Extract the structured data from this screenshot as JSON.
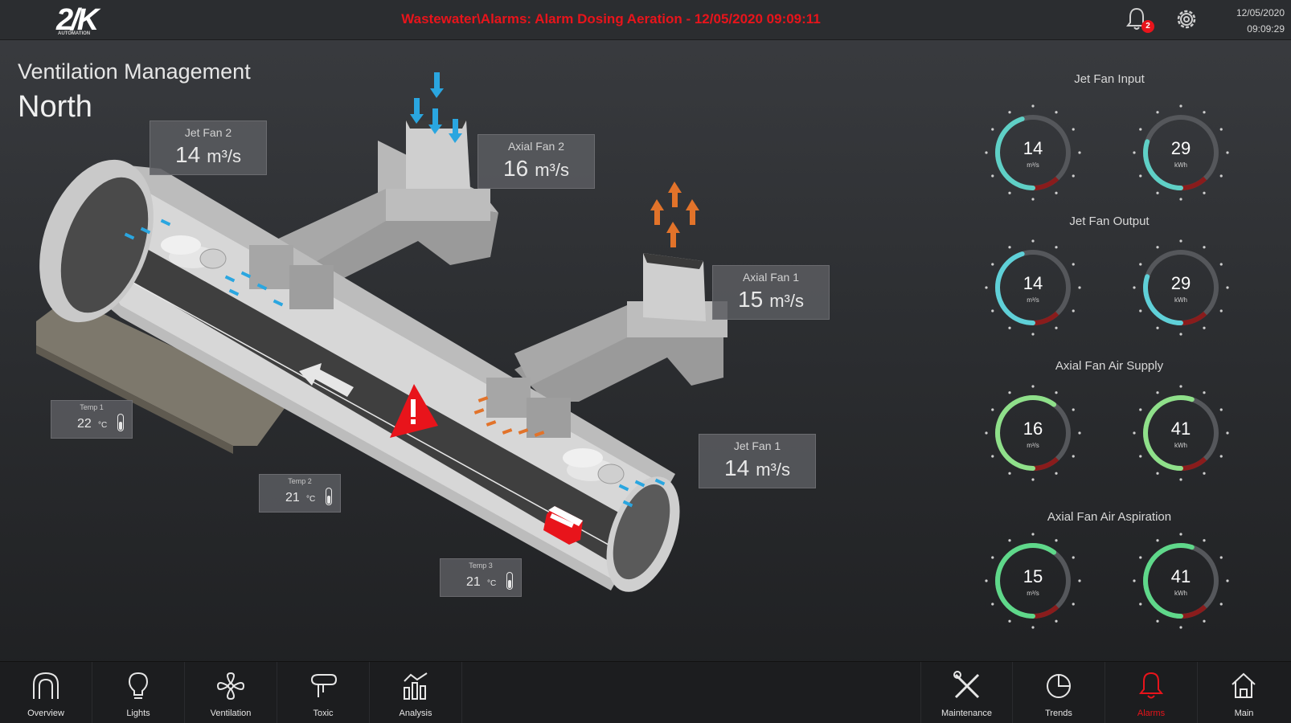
{
  "header": {
    "logo_text": "2/K",
    "logo_sub": "AUTOMATION",
    "alarm_message": "Wastewater\\Alarms: Alarm Dosing Aeration - 12/05/2020 09:09:11",
    "notification_count": "2",
    "date": "12/05/2020",
    "time": "09:09:29"
  },
  "page": {
    "subtitle": "Ventilation Management",
    "title": "North"
  },
  "readouts": {
    "jet_fan_2": {
      "label": "Jet Fan 2",
      "value": "14",
      "unit": "m³/s"
    },
    "axial_fan_2": {
      "label": "Axial Fan 2",
      "value": "16",
      "unit": "m³/s"
    },
    "axial_fan_1": {
      "label": "Axial Fan 1",
      "value": "15",
      "unit": "m³/s"
    },
    "jet_fan_1": {
      "label": "Jet Fan 1",
      "value": "14",
      "unit": "m³/s"
    }
  },
  "temps": {
    "temp_1": {
      "label": "Temp 1",
      "value": "22",
      "unit": "°C"
    },
    "temp_2": {
      "label": "Temp 2",
      "value": "21",
      "unit": "°C"
    },
    "temp_3": {
      "label": "Temp 3",
      "value": "21",
      "unit": "°C"
    }
  },
  "gauges": {
    "jet_fan_input": {
      "title": "Jet Fan Input",
      "flow": {
        "value": "14",
        "unit": "m³/s",
        "fraction": 0.45,
        "color": "#5fd0c6"
      },
      "power": {
        "value": "29",
        "unit": "kWh",
        "fraction": 0.3,
        "color": "#5fd0c6"
      }
    },
    "jet_fan_output": {
      "title": "Jet Fan Output",
      "flow": {
        "value": "14",
        "unit": "m³/s",
        "fraction": 0.45,
        "color": "#5fd0d8"
      },
      "power": {
        "value": "29",
        "unit": "kWh",
        "fraction": 0.3,
        "color": "#5fd0d8"
      }
    },
    "axial_fan_air_supply": {
      "title": "Axial Fan Air Supply",
      "flow": {
        "value": "16",
        "unit": "m³/s",
        "fraction": 0.6,
        "color": "#8fe08a"
      },
      "power": {
        "value": "41",
        "unit": "kWh",
        "fraction": 0.55,
        "color": "#8fe08a"
      }
    },
    "axial_fan_air_aspiration": {
      "title": "Axial Fan Air Aspiration",
      "flow": {
        "value": "15",
        "unit": "m³/s",
        "fraction": 0.6,
        "color": "#5fd88a"
      },
      "power": {
        "value": "41",
        "unit": "kWh",
        "fraction": 0.55,
        "color": "#5fd88a"
      }
    }
  },
  "nav": {
    "overview": "Overview",
    "lights": "Lights",
    "ventilation": "Ventilation",
    "toxic": "Toxic",
    "analysis": "Analysis",
    "maintenance": "Maintenance",
    "trends": "Trends",
    "alarms": "Alarms",
    "main": "Main"
  },
  "colors": {
    "alarm_red": "#e8141b",
    "airflow_blue": "#2aa6e0",
    "airflow_orange": "#e2732a"
  }
}
